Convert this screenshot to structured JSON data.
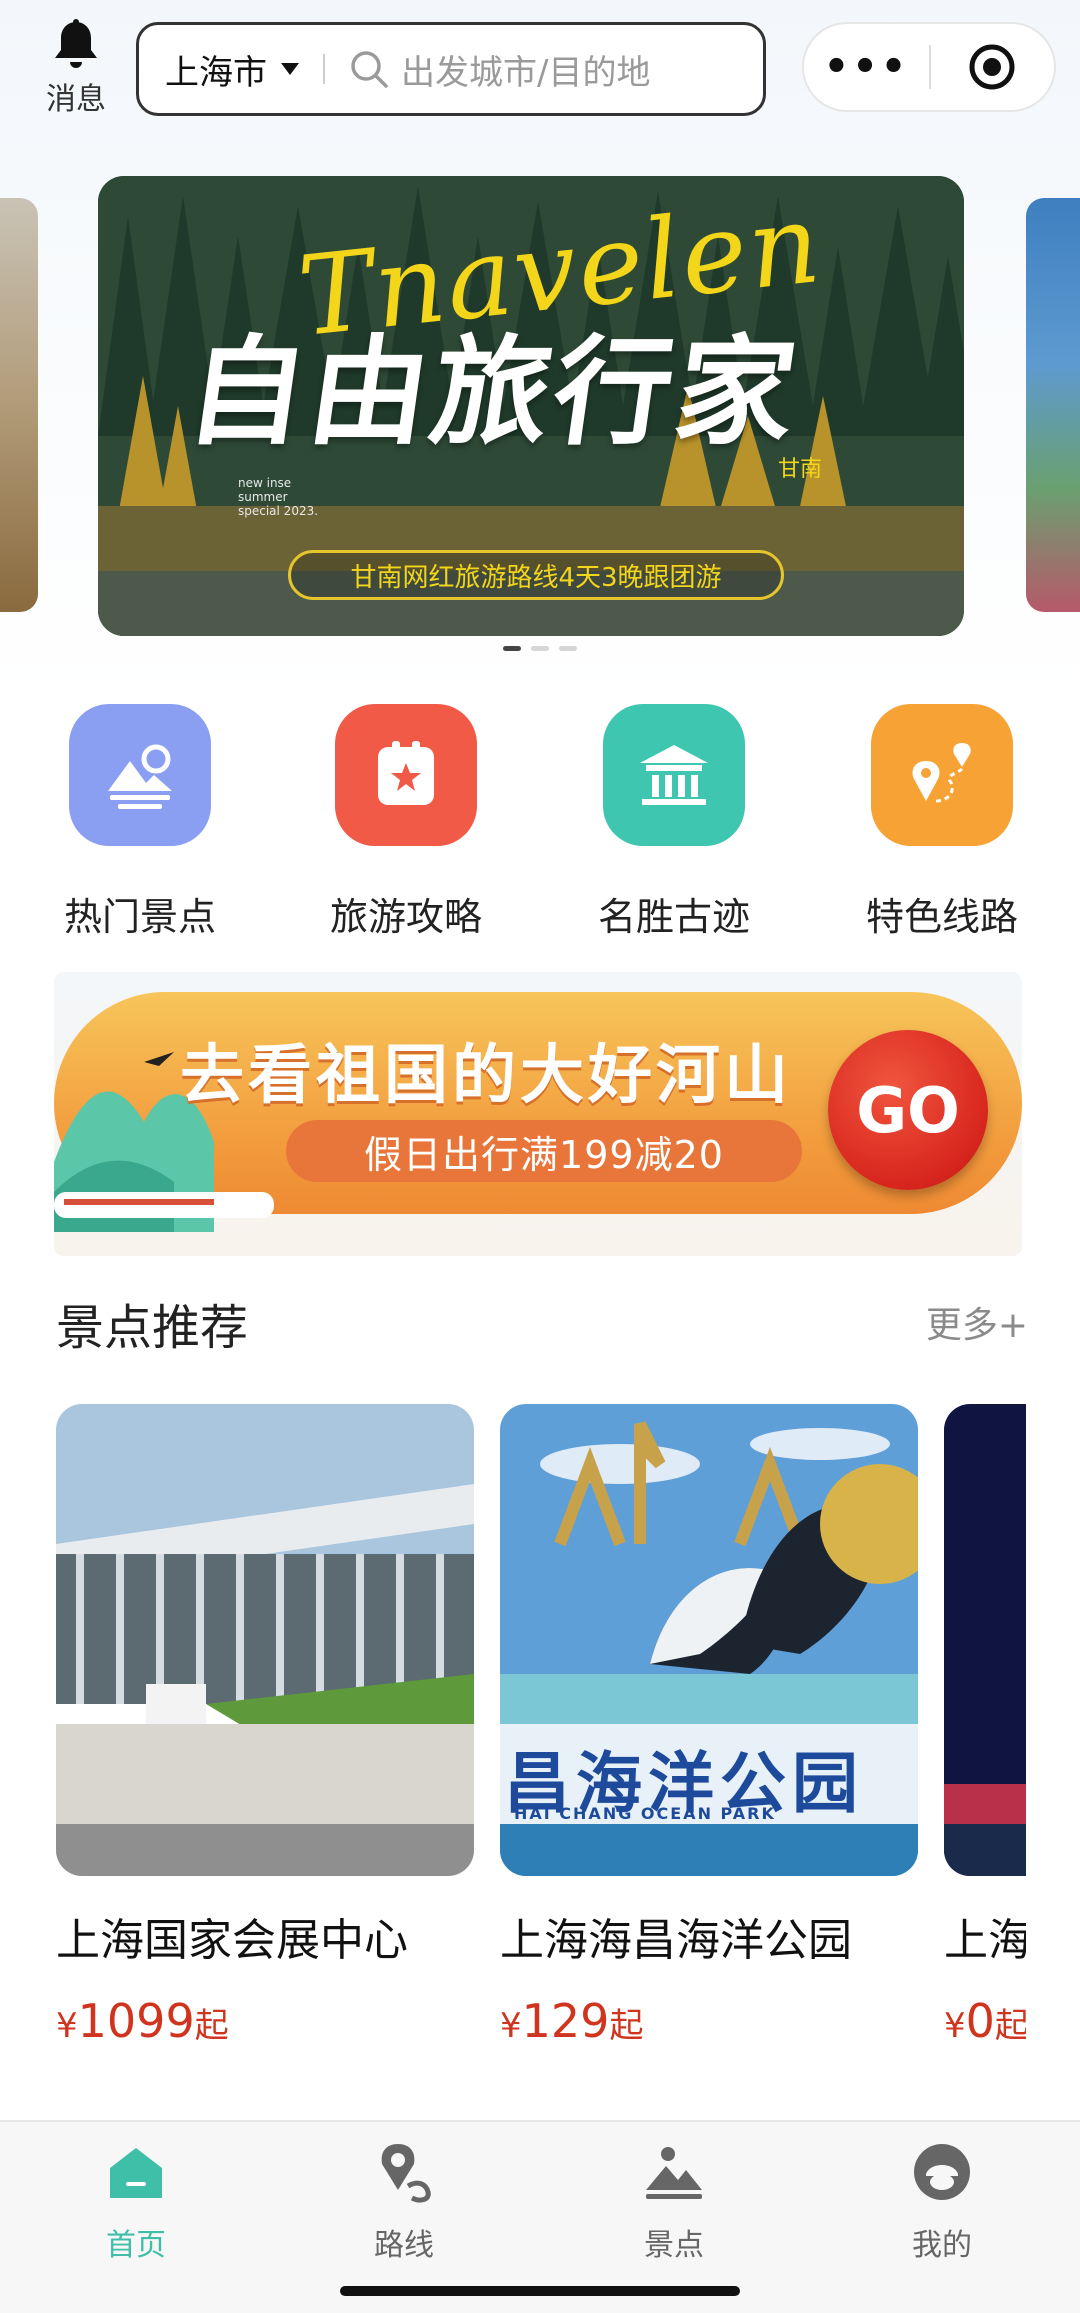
{
  "header": {
    "message_label": "消息",
    "city": "上海市",
    "search_placeholder": "出发城市/目的地"
  },
  "carousel": {
    "script_text": "Tnavelen",
    "title": "自由旅行家",
    "place_tag": "甘南",
    "small_note": "new inse summer special 2023.",
    "pill_text": "甘南网红旅游路线4天3晚跟团游",
    "dot_count": 3,
    "active_dot": 0
  },
  "quick_nav": [
    {
      "label": "热门景点",
      "icon": "mountain-icon",
      "color": "#8b9ff2"
    },
    {
      "label": "旅游攻略",
      "icon": "guide-book-icon",
      "color": "#f05a46"
    },
    {
      "label": "名胜古迹",
      "icon": "temple-icon",
      "color": "#3fc6b0"
    },
    {
      "label": "特色线路",
      "icon": "route-pin-icon",
      "color": "#f6a234"
    }
  ],
  "promo": {
    "line1": "去看祖国的大好河山",
    "line2": "假日出行满199减20",
    "go_label": "GO"
  },
  "section": {
    "title": "景点推荐",
    "more": "更多+"
  },
  "cards": [
    {
      "name": "上海国家会展中心",
      "currency": "¥",
      "price": "1099",
      "suffix": "起"
    },
    {
      "name": "上海海昌海洋公园",
      "currency": "¥",
      "price": "129",
      "suffix": "起",
      "sign_text": "昌海洋公园",
      "sign_sub": "HAI CHANG OCEAN PARK"
    },
    {
      "name": "上海",
      "currency": "¥",
      "price": "0",
      "suffix": "起"
    }
  ],
  "tabbar": [
    {
      "label": "首页",
      "icon": "home-icon",
      "active": true
    },
    {
      "label": "路线",
      "icon": "route-icon",
      "active": false
    },
    {
      "label": "景点",
      "icon": "scenic-icon",
      "active": false
    },
    {
      "label": "我的",
      "icon": "profile-icon",
      "active": false
    }
  ],
  "colors": {
    "accent": "#3fbfa8",
    "price": "#d0341e"
  }
}
